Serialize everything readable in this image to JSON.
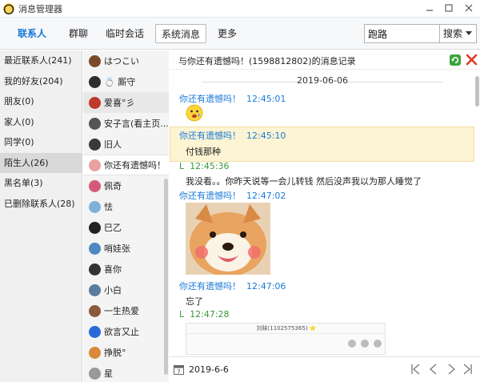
{
  "window": {
    "title": "消息管理器",
    "controls": [
      "minimize",
      "maximize",
      "close"
    ]
  },
  "tabs": [
    {
      "label": "联系人",
      "active": true
    },
    {
      "label": "群聊",
      "active": false
    },
    {
      "label": "临时会话",
      "active": false
    },
    {
      "label": "系统消息",
      "active": false,
      "boxed": true
    },
    {
      "label": "更多",
      "active": false
    }
  ],
  "search": {
    "value": "跑路",
    "button_label": "搜索"
  },
  "categories": [
    {
      "label": "最近联系人(241)",
      "selected": false
    },
    {
      "label": "我的好友(204)",
      "selected": false
    },
    {
      "label": "朋友(0)",
      "selected": false
    },
    {
      "label": "家人(0)",
      "selected": false
    },
    {
      "label": "同学(0)",
      "selected": false
    },
    {
      "label": "陌生人(26)",
      "selected": true
    },
    {
      "label": "黑名单(3)",
      "selected": false
    },
    {
      "label": "已删除联系人(28)",
      "selected": false
    }
  ],
  "contacts": [
    {
      "name": "はつこい",
      "color": "#7a4a2a"
    },
    {
      "name": "💍 厮守",
      "color": "#2d2d2d"
    },
    {
      "name": "爱喜°彡",
      "color": "#c0392b"
    },
    {
      "name": "安子言(看主页...",
      "color": "#555555"
    },
    {
      "name": "旧人",
      "color": "#3a3a3a"
    },
    {
      "name": "你还有遗憾吗！",
      "color": "#e8a0a0",
      "selected": true
    },
    {
      "name": "佩奇",
      "color": "#d45a78"
    },
    {
      "name": "怯",
      "color": "#7fb0d8"
    },
    {
      "name": "巳乙",
      "color": "#222222"
    },
    {
      "name": "哨娃张",
      "color": "#4d88c2"
    },
    {
      "name": "喜你",
      "color": "#333333"
    },
    {
      "name": "小白",
      "color": "#5a7aa0"
    },
    {
      "name": "一生热爱",
      "color": "#8a5a3a"
    },
    {
      "name": "欲言又止",
      "color": "#2a6ad8"
    },
    {
      "name": "挣脱°",
      "color": "#d88a3a"
    },
    {
      "name": "星",
      "color": "#999999"
    }
  ],
  "chat": {
    "title": "与你还有遗憾吗！(1598812802)的消息记录",
    "date_separator": "2019-06-06",
    "messages": [
      {
        "sender": "你还有遗憾吗！",
        "time": "12:45:01",
        "side": "them",
        "content": ""
      },
      {
        "sender": "你还有遗憾吗！",
        "time": "12:45:10",
        "side": "them",
        "content": "付钱那种",
        "highlighted": true
      },
      {
        "sender": "L",
        "time": "12:45:36",
        "side": "me",
        "content": "我没看。。你昨天说等一会儿转钱 然后没声我以为那人睡觉了"
      },
      {
        "sender": "你还有遗憾吗！",
        "time": "12:47:02",
        "side": "them",
        "content": ""
      },
      {
        "sender": "你还有遗憾吗！",
        "time": "12:47:06",
        "side": "them",
        "content": "忘了"
      },
      {
        "sender": "L",
        "time": "12:47:28",
        "side": "me",
        "content": ""
      }
    ],
    "screenshot_name": "刘昧(1102575365) ⭐"
  },
  "footer": {
    "date": "2019-6-6"
  },
  "colors": {
    "accent_blue": "#1a7ad8",
    "own_green": "#3a9a3a",
    "highlight_bg": "#fdf4d4"
  }
}
